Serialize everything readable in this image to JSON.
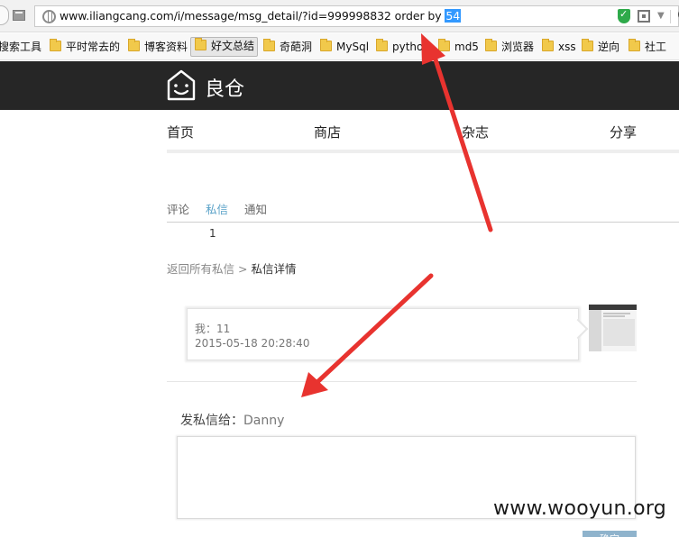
{
  "browser": {
    "url_text": "www.iliangcang.com/i/message/msg_detail/?id=999998832 order by ",
    "url_selected": "54",
    "bookmarks": [
      {
        "label": "搜索工具"
      },
      {
        "label": "平时常去的"
      },
      {
        "label": "博客资料"
      },
      {
        "label": "好文总结",
        "active": true
      },
      {
        "label": "奇葩洞"
      },
      {
        "label": "MySql"
      },
      {
        "label": "pytho"
      },
      {
        "label": "md5"
      },
      {
        "label": "浏览器"
      },
      {
        "label": "xss"
      },
      {
        "label": "逆向"
      },
      {
        "label": "社工"
      }
    ]
  },
  "site": {
    "logo_text": "良仓",
    "nav": [
      "首页",
      "商店",
      "杂志",
      "分享"
    ],
    "tabs": [
      {
        "label": "评论",
        "active": false
      },
      {
        "label": "私信",
        "active": true
      },
      {
        "label": "通知",
        "active": false
      }
    ],
    "message_count": "1",
    "breadcrumb": {
      "back": "返回所有私信",
      "separator": " > ",
      "current": "私信详情"
    },
    "message": {
      "content": "我：11",
      "timestamp": "2015-05-18 20:28:40"
    },
    "send": {
      "label": "发私信给：",
      "recipient": "Danny",
      "button": "确定"
    }
  },
  "watermark": "www.wooyun.org",
  "colors": {
    "header_bg": "#262626",
    "active_tab": "#5aa2c8",
    "selection": "#3399ff",
    "annotation_arrow": "#e8332f"
  }
}
